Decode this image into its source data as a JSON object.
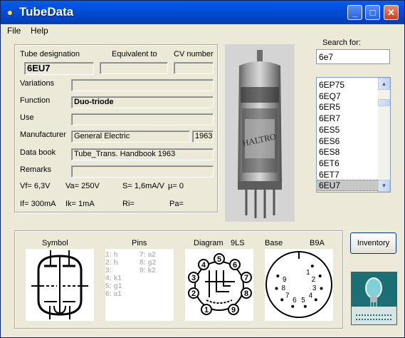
{
  "window": {
    "title": "TubeData",
    "minimize_glyph": "_",
    "maximize_glyph": "□",
    "close_glyph": "✕"
  },
  "menu": {
    "file": "File",
    "help": "Help"
  },
  "header_labels": {
    "designation": "Tube designation",
    "equivalent": "Equivalent to",
    "cv": "CV number"
  },
  "tube": {
    "designation": "6EU7",
    "equivalent": "",
    "cv_number": "",
    "variations": "",
    "function": "Duo-triode",
    "use": "",
    "manufacturer": "General Electric",
    "year": "1963",
    "data_book": "Tube_Trans. Handbook 1963",
    "remarks": ""
  },
  "field_labels": {
    "variations": "Variations",
    "function": "Function",
    "use": "Use",
    "manufacturer": "Manufacturer",
    "data_book": "Data book",
    "remarks": "Remarks"
  },
  "params": {
    "vf": "Vf= 6,3V",
    "va": "Va= 250V",
    "s": "S= 1,6mA/V",
    "mu": "µ=   0",
    "if": "If= 300mA",
    "ik": "Ik=  1mA",
    "ri": "Ri=",
    "pa": "Pa="
  },
  "photo": {
    "brand_text": "HALTRO"
  },
  "search": {
    "label": "Search for:",
    "value": "6e7"
  },
  "list": {
    "items": [
      "6EP75",
      "6EQ7",
      "6ER5",
      "6ER7",
      "6ES5",
      "6ES6",
      "6ES8",
      "6ET6",
      "6ET7",
      "6EU7"
    ],
    "selected": "6EU7"
  },
  "bottom": {
    "symbol_label": "Symbol",
    "pins_label": "Pins",
    "diagram_label": "Diagram",
    "diagram_code": "9LS",
    "base_label": "Base",
    "base_code": "B9A",
    "pins_col1": [
      "1: h",
      "2: h",
      "3:",
      "4: k1",
      "5: g1",
      "6: a1"
    ],
    "pins_col2": [
      "7: a2",
      "8: g2",
      "9: k2"
    ]
  },
  "diagram_pins": [
    "1",
    "2",
    "3",
    "4",
    "5",
    "6",
    "7",
    "8",
    "9"
  ],
  "base_pins": [
    "1",
    "2",
    "3",
    "4",
    "5",
    "6",
    "7",
    "8",
    "9"
  ],
  "inventory_button": "Inventory",
  "colors": {
    "title_bar": "#0055e5",
    "window_bg": "#ece9d8",
    "logo_bg": "#1c6f74"
  },
  "icons": {
    "app": "lightbulb-icon",
    "scroll_up": "up-arrow-icon",
    "scroll_down": "down-arrow-icon"
  }
}
